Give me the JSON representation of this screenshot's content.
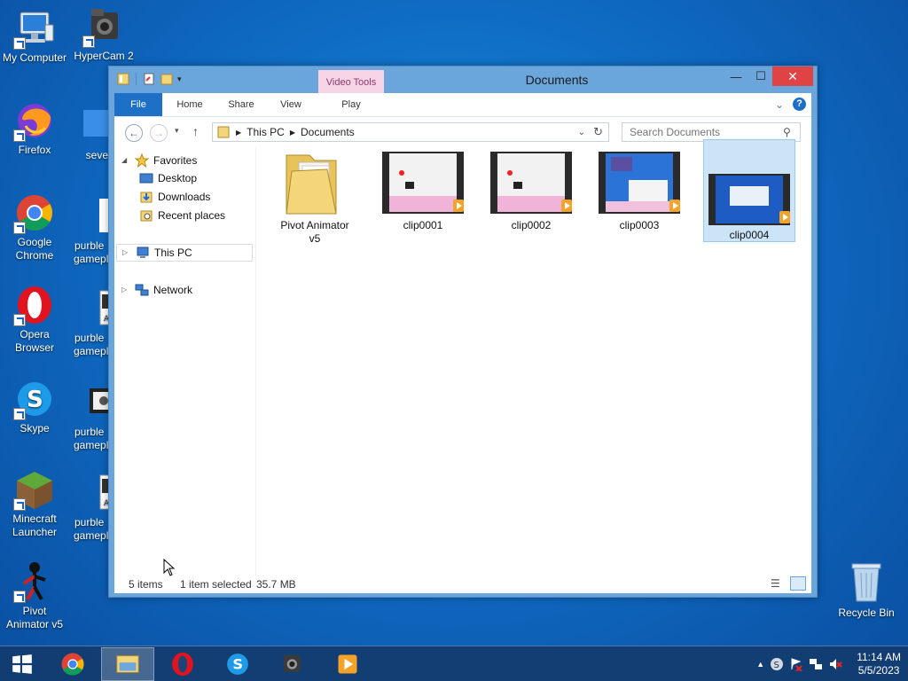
{
  "desktop": {
    "icons": [
      {
        "label_lines": [
          "My Computer"
        ],
        "icon": "computer-icon"
      },
      {
        "label_lines": [
          "HyperCam 2"
        ],
        "icon": "hypercam-icon"
      },
      {
        "label_lines": [
          "Firefox"
        ],
        "icon": "firefox-icon"
      },
      {
        "label_lines": [
          "seve"
        ],
        "icon": "shortcut-icon"
      },
      {
        "label_lines": [
          "Google",
          "Chrome"
        ],
        "icon": "chrome-icon"
      },
      {
        "label_lines": [
          "purble",
          "gamepl"
        ],
        "icon": "file-icon"
      },
      {
        "label_lines": [
          "Opera",
          "Browser"
        ],
        "icon": "opera-icon"
      },
      {
        "label_lines": [
          "purble",
          "gamepl"
        ],
        "icon": "avi-icon"
      },
      {
        "label_lines": [
          "Skype"
        ],
        "icon": "skype-icon"
      },
      {
        "label_lines": [
          "purble",
          "gamepl"
        ],
        "icon": "video-icon"
      },
      {
        "label_lines": [
          "Minecraft",
          "Launcher"
        ],
        "icon": "minecraft-icon"
      },
      {
        "label_lines": [
          "purble",
          "gamepl"
        ],
        "icon": "avi-icon"
      },
      {
        "label_lines": [
          "Pivot",
          "Animator v5"
        ],
        "icon": "pivot-icon"
      }
    ],
    "recycle_bin": "Recycle Bin"
  },
  "window": {
    "title": "Documents",
    "contextual_tab_group": "Video Tools",
    "controls": {
      "minimize": "—",
      "maximize": "☐",
      "close": "✕"
    },
    "ribbon_tabs": [
      "File",
      "Home",
      "Share",
      "View",
      "Play"
    ],
    "help": "?",
    "address": {
      "back": "←",
      "forward": "→",
      "up": "↑",
      "crumbs": [
        "This PC",
        "Documents"
      ],
      "refresh": "↻"
    },
    "search": {
      "placeholder": "Search Documents"
    },
    "nav_pane": {
      "favorites": "Favorites",
      "favorite_items": [
        "Desktop",
        "Downloads",
        "Recent places"
      ],
      "this_pc": "This PC",
      "network": "Network"
    },
    "files": [
      {
        "name_lines": [
          "Pivot Animator",
          "v5"
        ],
        "type": "folder",
        "selected": false
      },
      {
        "name_lines": [
          "clip0001"
        ],
        "type": "video",
        "selected": false
      },
      {
        "name_lines": [
          "clip0002"
        ],
        "type": "video",
        "selected": false
      },
      {
        "name_lines": [
          "clip0003"
        ],
        "type": "video",
        "selected": false
      },
      {
        "name_lines": [
          "clip0004"
        ],
        "type": "video",
        "selected": true
      }
    ],
    "status": {
      "count": "5 items",
      "selection": "1 item selected",
      "size": "35.7 MB"
    }
  },
  "taskbar": {
    "apps": [
      "start-icon",
      "chrome-icon",
      "file-explorer-icon",
      "opera-icon",
      "skype-icon",
      "hypercam-icon",
      "media-player-icon"
    ],
    "active": "file-explorer-icon",
    "clock": {
      "time": "11:14 AM",
      "date": "5/5/2023"
    }
  }
}
